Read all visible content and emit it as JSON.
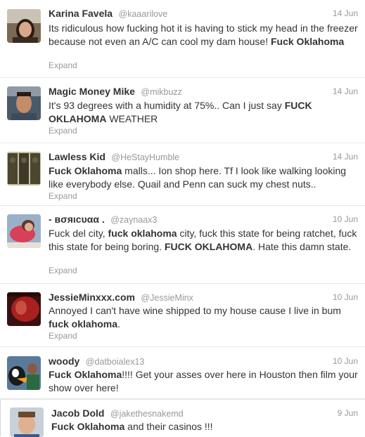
{
  "tweets": [
    {
      "fullname": "Karina Favela",
      "username": "@kaaarilove",
      "time": "14 Jun",
      "segments": [
        {
          "t": "Its ridiculous how fucking hot it is having to stick my head in the freezer because not even an A/C can cool my dam house! "
        },
        {
          "t": "Fuck Oklahoma",
          "b": true
        }
      ],
      "expand": "Expand"
    },
    {
      "fullname": "Magic Money Mike",
      "username": "@mikbuzz",
      "time": "14 Jun",
      "segments": [
        {
          "t": "It's 93 degrees with a humidity at 75%.. Can I just say "
        },
        {
          "t": "FUCK OKLAHOMA",
          "b": true
        },
        {
          "t": " WEATHER"
        }
      ],
      "expand": "Expand"
    },
    {
      "fullname": "Lawless Kid",
      "username": "@HeStayHumble",
      "time": "14 Jun",
      "segments": [
        {
          "t": "Fuck Oklahoma",
          "b": true
        },
        {
          "t": " malls... Ion shop here. Tf I look like walking looking like everybody else. Quail and Penn can suck my chest nuts.."
        }
      ],
      "expand": "Expand"
    },
    {
      "fullname": "- ʙσяιcυαα .",
      "username": "@zaynaax3",
      "time": "10 Jun",
      "segments": [
        {
          "t": "Fuck del city, "
        },
        {
          "t": "fuck oklahoma",
          "b": true
        },
        {
          "t": " city, fuck this state for being ratchet, fuck this state for being boring. "
        },
        {
          "t": "FUCK OKLAHOMA",
          "b": true
        },
        {
          "t": ". Hate this damn state."
        }
      ],
      "expand": "Expand"
    },
    {
      "fullname": "JessieMinxxx.com",
      "username": "@JessieMinx",
      "time": "10 Jun",
      "segments": [
        {
          "t": "Annoyed I can't have wine shipped to my house cause I live in bum "
        },
        {
          "t": "fuck oklahoma",
          "b": true
        },
        {
          "t": "."
        }
      ],
      "expand": "Expand"
    },
    {
      "fullname": "woody",
      "username": "@datboialex13",
      "time": "10 Jun",
      "segments": [
        {
          "t": "Fuck Oklahoma",
          "b": true
        },
        {
          "t": "!!!! Get your asses over here in Houston then film your show over here!"
        }
      ],
      "expand": ""
    },
    {
      "fullname": "Jacob Dold",
      "username": "@jakethesnakemd",
      "time": "9 Jun",
      "segments": [
        {
          "t": "Fuck Oklahoma",
          "b": true
        },
        {
          "t": " and their casinos !!!"
        }
      ],
      "expand": ""
    }
  ]
}
